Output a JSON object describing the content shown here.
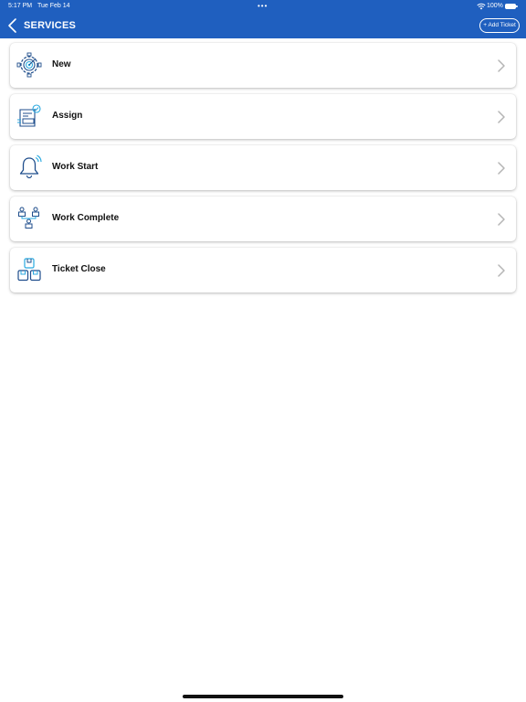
{
  "status_bar": {
    "time": "5:17 PM",
    "date": "Tue Feb 14",
    "dots": "•••",
    "battery": "100%"
  },
  "header": {
    "title": "SERVICES",
    "add_ticket_label": "+ Add Ticket",
    "background_color": "#1f5fbf"
  },
  "services": [
    {
      "label": "New",
      "icon": "target-gear-icon"
    },
    {
      "label": "Assign",
      "icon": "assign-form-icon"
    },
    {
      "label": "Work Start",
      "icon": "bell-ringing-icon"
    },
    {
      "label": "Work Complete",
      "icon": "hierarchy-people-icon"
    },
    {
      "label": "Ticket Close",
      "icon": "boxes-icon"
    }
  ],
  "colors": {
    "icon_dark": "#1f4e8c",
    "icon_light": "#29a9e0",
    "chevron": "#b5b5b5"
  }
}
